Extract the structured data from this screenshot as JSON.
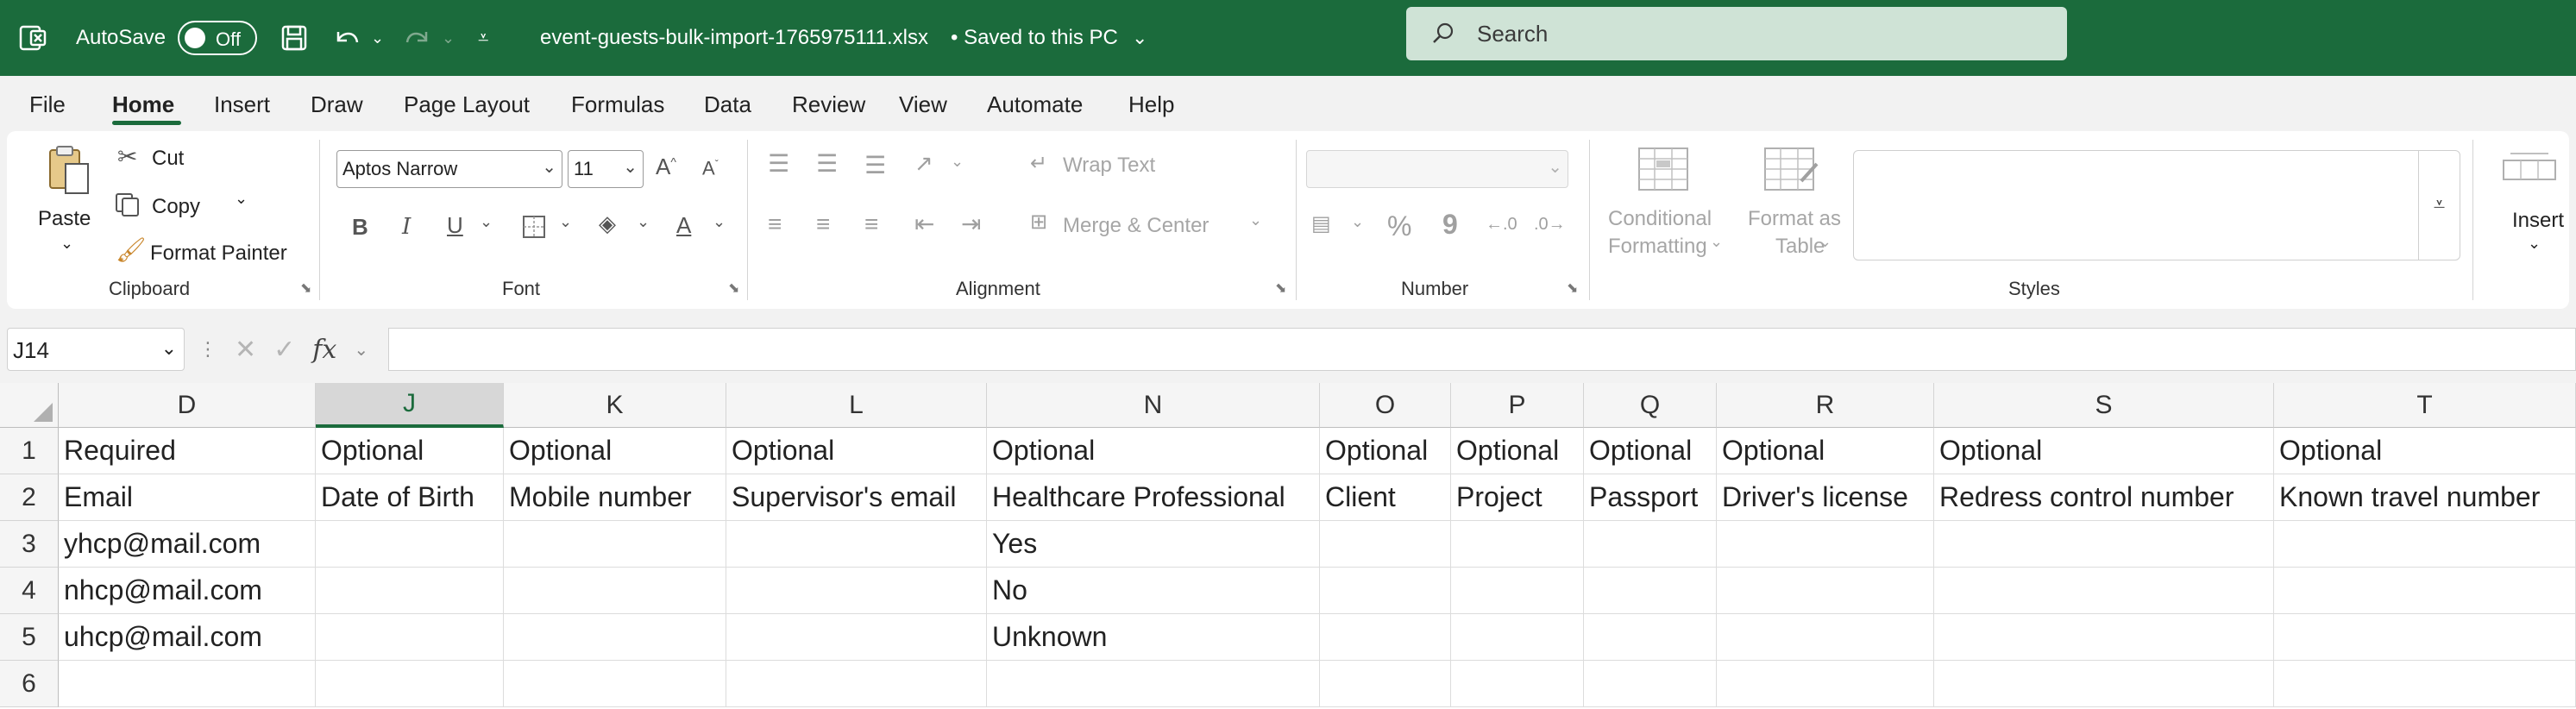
{
  "titlebar": {
    "autosave_label": "AutoSave",
    "autosave_state": "Off",
    "filename": "event-guests-bulk-import-1765975111.xlsx",
    "save_status": "•  Saved to this PC",
    "search_placeholder": "Search"
  },
  "menu": {
    "items": [
      "File",
      "Home",
      "Insert",
      "Draw",
      "Page Layout",
      "Formulas",
      "Data",
      "Review",
      "View",
      "Automate",
      "Help"
    ],
    "active": "Home"
  },
  "ribbon": {
    "clipboard": {
      "paste": "Paste",
      "cut": "Cut",
      "copy": "Copy",
      "format_painter": "Format Painter",
      "label": "Clipboard"
    },
    "font": {
      "font_name": "Aptos Narrow",
      "font_size": "11",
      "label": "Font"
    },
    "alignment": {
      "wrap_text": "Wrap Text",
      "merge_center": "Merge & Center",
      "label": "Alignment"
    },
    "number": {
      "percent": "%",
      "comma": "9",
      "label": "Number"
    },
    "styles": {
      "conditional_1": "Conditional",
      "conditional_2": "Formatting",
      "format_table_1": "Format as",
      "format_table_2": "Table",
      "label": "Styles"
    },
    "cells": {
      "insert": "Insert"
    }
  },
  "formula_bar": {
    "name_box": "J14",
    "fx": "fx",
    "formula": ""
  },
  "sheet": {
    "columns": [
      "D",
      "J",
      "K",
      "L",
      "N",
      "O",
      "P",
      "Q",
      "R",
      "S",
      "T"
    ],
    "selected_column": "J",
    "rows": [
      "1",
      "2",
      "3",
      "4",
      "5",
      "6"
    ],
    "cells": [
      [
        "Required",
        "Optional",
        "Optional",
        "Optional",
        "Optional",
        "Optional",
        "Optional",
        "Optional",
        "Optional",
        "Optional",
        "Optional"
      ],
      [
        "Email",
        "Date of Birth",
        "Mobile number",
        "Supervisor's email",
        "Healthcare Professional",
        "Client",
        "Project",
        "Passport",
        "Driver's license",
        "Redress control number",
        "Known travel number"
      ],
      [
        "yhcp@mail.com",
        "",
        "",
        "",
        "Yes",
        "",
        "",
        "",
        "",
        "",
        ""
      ],
      [
        "nhcp@mail.com",
        "",
        "",
        "",
        "No",
        "",
        "",
        "",
        "",
        "",
        ""
      ],
      [
        "uhcp@mail.com",
        "",
        "",
        "",
        "Unknown",
        "",
        "",
        "",
        "",
        "",
        ""
      ],
      [
        "",
        "",
        "",
        "",
        "",
        "",
        "",
        "",
        "",
        "",
        ""
      ]
    ]
  },
  "colors": {
    "accent": "#1b6b3c",
    "ribbon_bg": "#f2f2f2"
  }
}
